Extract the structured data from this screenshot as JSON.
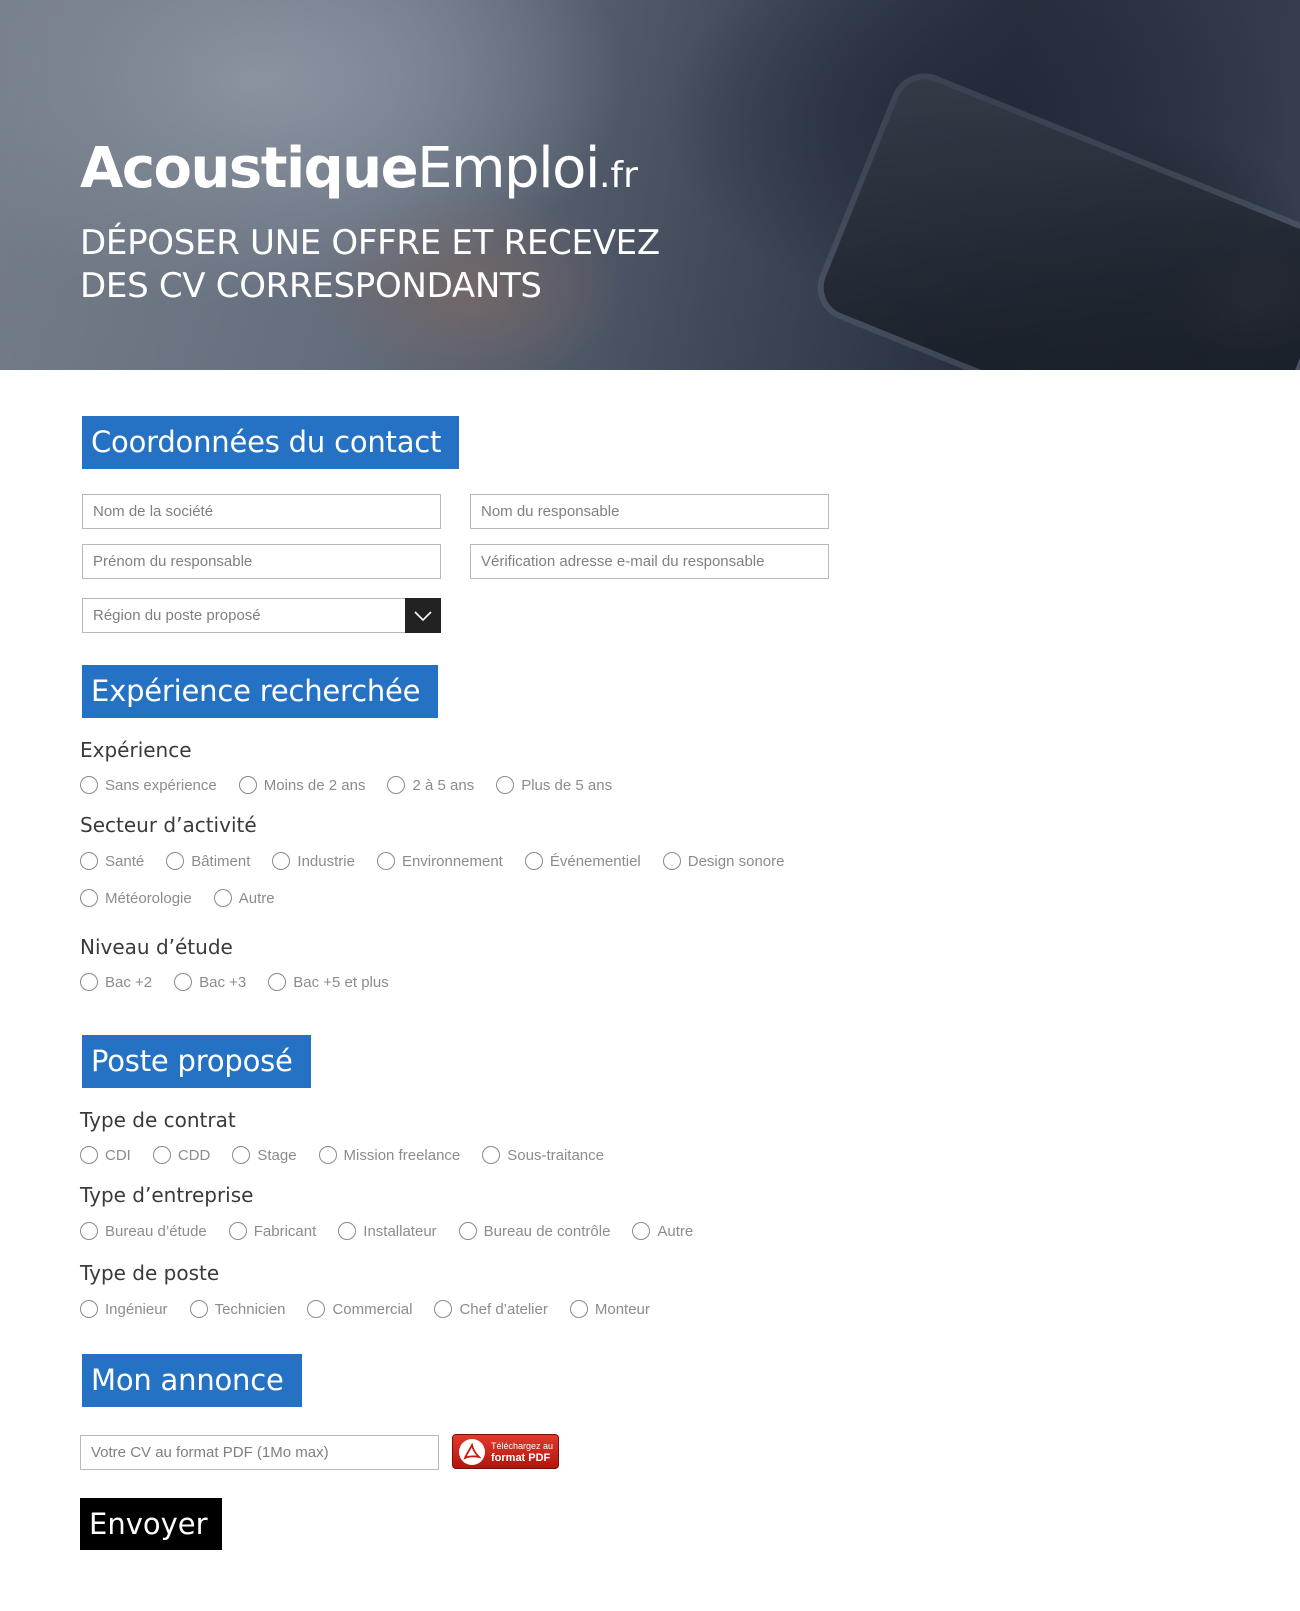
{
  "hero": {
    "logo": {
      "bold": "Acoustique",
      "normal": "Emploi",
      "tld": ".fr"
    },
    "tagline_line1": "DÉPOSER UNE OFFRE ET RECEVEZ",
    "tagline_line2": "DES CV CORRESPONDANTS"
  },
  "contact": {
    "title": "Coordonnées du contact",
    "company_placeholder": "Nom de la société",
    "manager_name_placeholder": "Nom du responsable",
    "manager_firstname_placeholder": "Prénom du responsable",
    "email_check_placeholder": "Vérification adresse e-mail du responsable",
    "region_select_label": "Région du poste proposé"
  },
  "experience_section": {
    "title": "Expérience recherchée",
    "experience_label": "Expérience",
    "experience_options": [
      "Sans expérience",
      "Moins de 2 ans",
      "2 à 5 ans",
      "Plus de 5 ans"
    ],
    "sector_label": "Secteur d’activité",
    "sector_options_row1": [
      "Santé",
      "Bâtiment",
      "Industrie",
      "Environnement",
      "Événementiel",
      "Design sonore"
    ],
    "sector_options_row2": [
      "Météorologie",
      "Autre"
    ],
    "education_label": "Niveau d’étude",
    "education_options": [
      "Bac +2",
      "Bac +3",
      "Bac +5 et plus"
    ]
  },
  "position_section": {
    "title": "Poste proposé",
    "contract_label": "Type de contrat",
    "contract_options": [
      "CDI",
      "CDD",
      "Stage",
      "Mission freelance",
      "Sous-traitance"
    ],
    "company_type_label": "Type d’entreprise",
    "company_type_options": [
      "Bureau d’étude",
      "Fabricant",
      "Installateur",
      "Bureau de contrôle",
      "Autre"
    ],
    "job_type_label": "Type de poste",
    "job_type_options": [
      "Ingénieur",
      "Technicien",
      "Commercial",
      "Chef d’atelier",
      "Monteur"
    ]
  },
  "announcement": {
    "title": "Mon annonce",
    "cv_placeholder": "Votre CV au format PDF (1Mo max)",
    "pdf_button_line1": "Téléchargez au",
    "pdf_button_line2": "format PDF"
  },
  "submit_label": "Envoyer",
  "colors": {
    "section_blue": "#2572c4",
    "submit_black": "#000000",
    "pdf_red": "#c4190f"
  }
}
